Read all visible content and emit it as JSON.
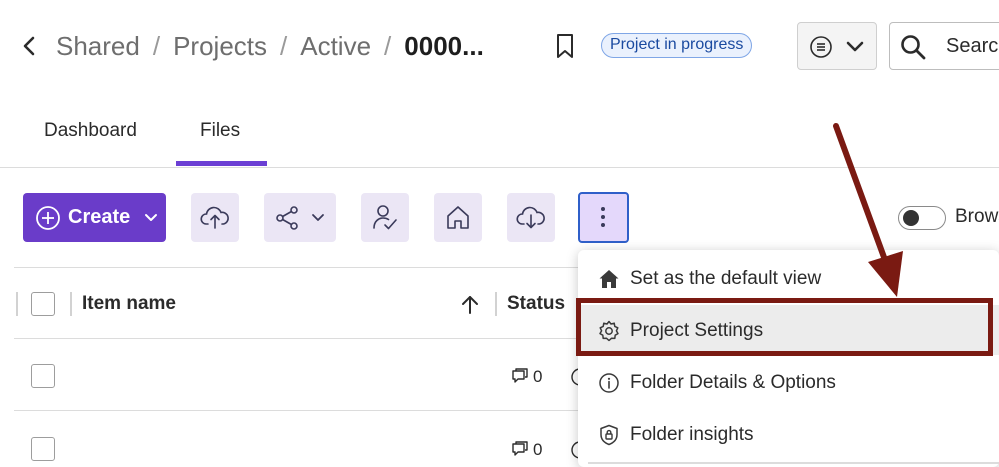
{
  "header": {
    "breadcrumb": [
      "Shared",
      "Projects",
      "Active"
    ],
    "current": "0000...",
    "separator": "/",
    "status_badge": "Project in progress",
    "search_placeholder": "Search"
  },
  "tabs": [
    {
      "label": "Dashboard",
      "active": false
    },
    {
      "label": "Files",
      "active": true
    }
  ],
  "toolbar": {
    "create_label": "Create",
    "toggle_label": "Browse",
    "tool_icons": [
      "cloud-upload-icon",
      "share-icon",
      "user-approve-icon",
      "home-icon",
      "cloud-download-icon"
    ],
    "more_icon": "kebab-icon"
  },
  "table": {
    "columns": [
      "Item name",
      "Status"
    ],
    "rows": [
      {
        "comments": "0"
      },
      {
        "comments": "0"
      }
    ]
  },
  "menu": {
    "items": [
      {
        "icon": "home-icon",
        "label": "Set as the default view"
      },
      {
        "icon": "gear-icon",
        "label": "Project Settings",
        "highlighted": true
      },
      {
        "icon": "info-icon",
        "label": "Folder Details & Options"
      },
      {
        "icon": "shield-lock-icon",
        "label": "Folder insights"
      }
    ]
  },
  "colors": {
    "accent": "#6a3cc9",
    "tab_underline": "#6b3fd4",
    "annotation": "#7a1a12",
    "status_badge_border": "#7fa6e6",
    "more_button_border": "#2f5fc9"
  }
}
